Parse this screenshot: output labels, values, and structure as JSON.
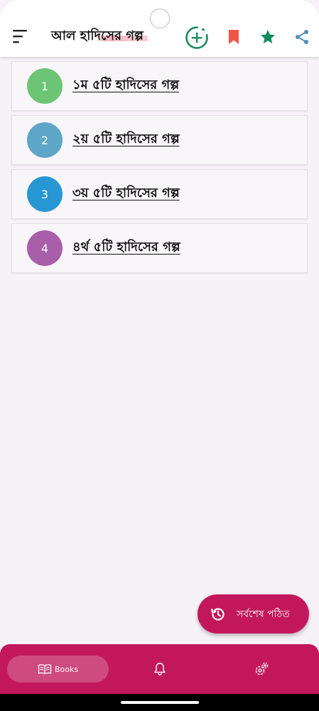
{
  "header": {
    "title": "আল হাদিসের গল্প",
    "icons": [
      "menu-icon",
      "add-circle-icon",
      "bookmark-icon",
      "star-icon",
      "share-icon"
    ]
  },
  "list": {
    "items": [
      {
        "number": "1",
        "label": "১ম ৫টি হাদিসের গল্প",
        "color": "#6cc574"
      },
      {
        "number": "2",
        "label": "২য় ৫টি হাদিসের গল্প",
        "color": "#5ea6c7"
      },
      {
        "number": "3",
        "label": "৩য় ৫টি হাদিসের গল্প",
        "color": "#2797d3"
      },
      {
        "number": "4",
        "label": "৪র্থ ৫টি হাদিসের গল্প",
        "color": "#a85ea8"
      }
    ]
  },
  "fab": {
    "label": "সর্বশেষ পঠিত",
    "icon": "history-icon"
  },
  "bottom_nav": {
    "books_label": "Books",
    "icons": [
      "book-icon",
      "bell-icon",
      "settings-icon"
    ]
  },
  "colors": {
    "accent": "#c2185b",
    "add_icon": "#1a8a5a",
    "bookmark": "#f05545",
    "star": "#0f8a5b",
    "share": "#4a90b8",
    "background": "#f6f2f8"
  }
}
